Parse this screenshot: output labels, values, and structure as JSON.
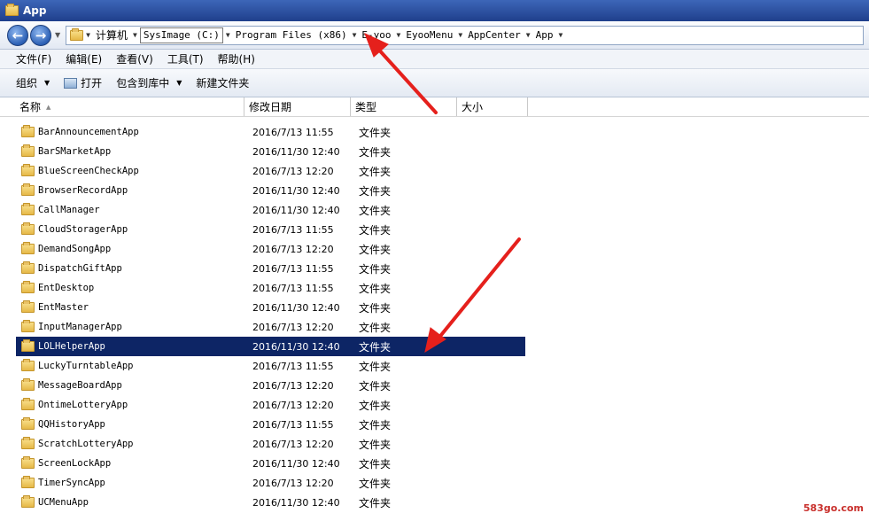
{
  "window": {
    "title": "App"
  },
  "address": {
    "crumbs": [
      "计算机",
      "SysImage (C:)",
      "Program Files (x86)",
      "E-yoo",
      "EyooMenu",
      "AppCenter",
      "App"
    ]
  },
  "menu": {
    "items": [
      "文件(F)",
      "编辑(E)",
      "查看(V)",
      "工具(T)",
      "帮助(H)"
    ]
  },
  "toolbar": {
    "organize": "组织",
    "open": "打开",
    "include_library": "包含到库中",
    "new_folder": "新建文件夹"
  },
  "columns": {
    "name": "名称",
    "date": "修改日期",
    "type": "类型",
    "size": "大小"
  },
  "files": [
    {
      "name": "BarAnnouncementApp",
      "date": "2016/7/13 11:55",
      "type": "文件夹"
    },
    {
      "name": "BarSMarketApp",
      "date": "2016/11/30 12:40",
      "type": "文件夹"
    },
    {
      "name": "BlueScreenCheckApp",
      "date": "2016/7/13 12:20",
      "type": "文件夹"
    },
    {
      "name": "BrowserRecordApp",
      "date": "2016/11/30 12:40",
      "type": "文件夹"
    },
    {
      "name": "CallManager",
      "date": "2016/11/30 12:40",
      "type": "文件夹"
    },
    {
      "name": "CloudStoragerApp",
      "date": "2016/7/13 11:55",
      "type": "文件夹"
    },
    {
      "name": "DemandSongApp",
      "date": "2016/7/13 12:20",
      "type": "文件夹"
    },
    {
      "name": "DispatchGiftApp",
      "date": "2016/7/13 11:55",
      "type": "文件夹"
    },
    {
      "name": "EntDesktop",
      "date": "2016/7/13 11:55",
      "type": "文件夹"
    },
    {
      "name": "EntMaster",
      "date": "2016/11/30 12:40",
      "type": "文件夹"
    },
    {
      "name": "InputManagerApp",
      "date": "2016/7/13 12:20",
      "type": "文件夹"
    },
    {
      "name": "LOLHelperApp",
      "date": "2016/11/30 12:40",
      "type": "文件夹",
      "selected": true
    },
    {
      "name": "LuckyTurntableApp",
      "date": "2016/7/13 11:55",
      "type": "文件夹"
    },
    {
      "name": "MessageBoardApp",
      "date": "2016/7/13 12:20",
      "type": "文件夹"
    },
    {
      "name": "OntimeLotteryApp",
      "date": "2016/7/13 12:20",
      "type": "文件夹"
    },
    {
      "name": "QQHistoryApp",
      "date": "2016/7/13 11:55",
      "type": "文件夹"
    },
    {
      "name": "ScratchLotteryApp",
      "date": "2016/7/13 12:20",
      "type": "文件夹"
    },
    {
      "name": "ScreenLockApp",
      "date": "2016/11/30 12:40",
      "type": "文件夹"
    },
    {
      "name": "TimerSyncApp",
      "date": "2016/7/13 12:20",
      "type": "文件夹"
    },
    {
      "name": "UCMenuApp",
      "date": "2016/11/30 12:40",
      "type": "文件夹"
    }
  ],
  "watermark": "583go.com",
  "colors": {
    "selection": "#0d2565",
    "arrow": "#e5201c",
    "title_bar": "#2a4f9e"
  }
}
